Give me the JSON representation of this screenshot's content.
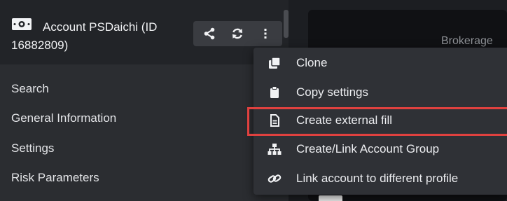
{
  "header": {
    "account_title": "Account PSDaichi (ID 16882809)",
    "toolbar": {
      "share_icon": "share-icon",
      "refresh_icon": "refresh-icon",
      "more_icon": "more-vertical-icon"
    }
  },
  "sidebar": {
    "items": [
      {
        "label": "Search"
      },
      {
        "label": "General Information"
      },
      {
        "label": "Settings"
      },
      {
        "label": "Risk Parameters"
      }
    ]
  },
  "content": {
    "partial_heading": "Brokerage"
  },
  "menu": {
    "items": [
      {
        "label": "Clone",
        "icon": "clone-icon"
      },
      {
        "label": "Copy settings",
        "icon": "clipboard-icon"
      },
      {
        "label": "Create external fill",
        "icon": "file-icon",
        "highlighted": true
      },
      {
        "label": "Create/Link Account Group",
        "icon": "sitemap-icon"
      },
      {
        "label": "Link account to different profile",
        "icon": "link-icon"
      }
    ]
  },
  "colors": {
    "highlight": "#e0413f",
    "menu_bg": "#2f3136",
    "sidebar_bg": "#2b2d31"
  }
}
